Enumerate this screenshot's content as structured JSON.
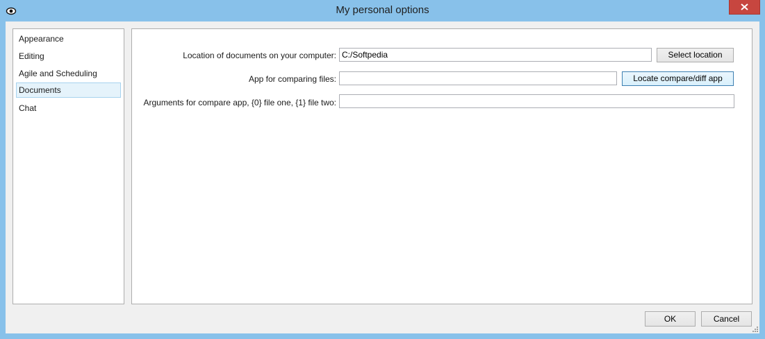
{
  "window": {
    "title": "My personal options"
  },
  "sidebar": {
    "items": [
      {
        "label": "Appearance",
        "selected": false
      },
      {
        "label": "Editing",
        "selected": false
      },
      {
        "label": "Agile and Scheduling",
        "selected": false
      },
      {
        "label": "Documents",
        "selected": true
      },
      {
        "label": "Chat",
        "selected": false
      }
    ]
  },
  "documents": {
    "location_label": "Location of documents on your computer:",
    "location_value": "C:/Softpedia",
    "select_location_button": "Select location",
    "compare_app_label": "App for comparing files:",
    "compare_app_value": "",
    "locate_compare_button": "Locate compare/diff app",
    "arguments_label": "Arguments for compare app, {0} file one, {1} file two:",
    "arguments_value": ""
  },
  "footer": {
    "ok_label": "OK",
    "cancel_label": "Cancel"
  },
  "colors": {
    "title_bar": "#88c1ea",
    "close_button": "#c7463f",
    "selected_item": "#e5f3fb"
  }
}
